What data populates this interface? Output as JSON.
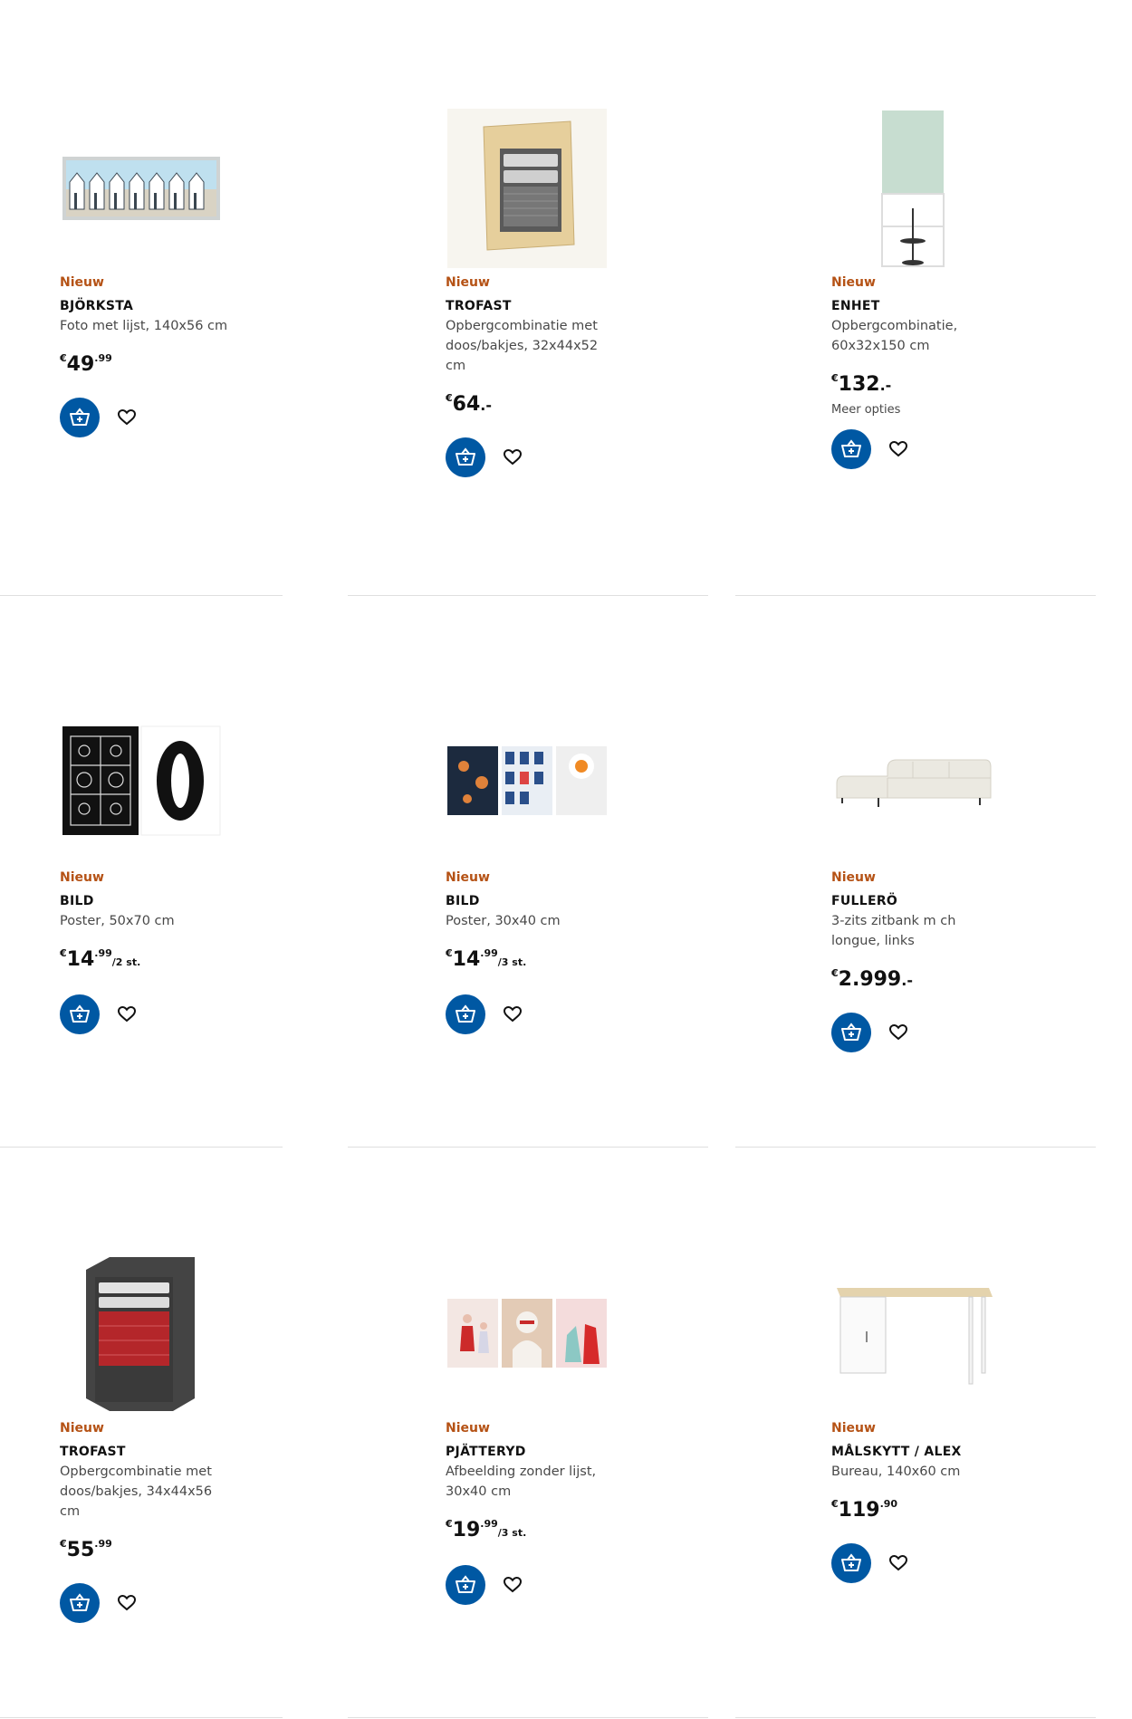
{
  "products": [
    {
      "badge": "Nieuw",
      "name": "BJÖRKSTA",
      "desc": "Foto met lijst, 140x56 cm",
      "price_main": "49",
      "price_dec": ".99",
      "unit": "",
      "more": ""
    },
    {
      "badge": "Nieuw",
      "name": "TROFAST",
      "desc": "Opbergcombinatie met doos/bakjes, 32x44x52 cm",
      "price_main": "64",
      "price_dec": ".-",
      "unit": "",
      "more": ""
    },
    {
      "badge": "Nieuw",
      "name": "ENHET",
      "desc": "Opbergcombinatie, 60x32x150 cm",
      "price_main": "132",
      "price_dec": ".-",
      "unit": "",
      "more": "Meer opties"
    },
    {
      "badge": "Nieuw",
      "name": "BILD",
      "desc": "Poster, 50x70 cm",
      "price_main": "14",
      "price_dec": ".99",
      "unit": "/2 st.",
      "more": ""
    },
    {
      "badge": "Nieuw",
      "name": "BILD",
      "desc": "Poster, 30x40 cm",
      "price_main": "14",
      "price_dec": ".99",
      "unit": "/3 st.",
      "more": ""
    },
    {
      "badge": "Nieuw",
      "name": "FULLERÖ",
      "desc": "3-zits zitbank m ch longue, links",
      "price_main": "2.999",
      "price_dec": ".-",
      "unit": "",
      "more": ""
    },
    {
      "badge": "Nieuw",
      "name": "TROFAST",
      "desc": "Opbergcombinatie met doos/bakjes, 34x44x56 cm",
      "price_main": "55",
      "price_dec": ".99",
      "unit": "",
      "more": ""
    },
    {
      "badge": "Nieuw",
      "name": "PJÄTTERYD",
      "desc": "Afbeelding zonder lijst, 30x40 cm",
      "price_main": "19",
      "price_dec": ".99",
      "unit": "/3 st.",
      "more": ""
    },
    {
      "badge": "Nieuw",
      "name": "MÅLSKYTT / ALEX",
      "desc": "Bureau, 140x60 cm",
      "price_main": "119",
      "price_dec": ".90",
      "unit": "",
      "more": ""
    }
  ],
  "currency_symbol": "€",
  "icons": {
    "cart": "add-to-cart-icon",
    "favourite": "heart-icon"
  },
  "colors": {
    "accent_blue": "#0058a3",
    "badge_orange": "#b55215",
    "text_secondary": "#484848"
  }
}
